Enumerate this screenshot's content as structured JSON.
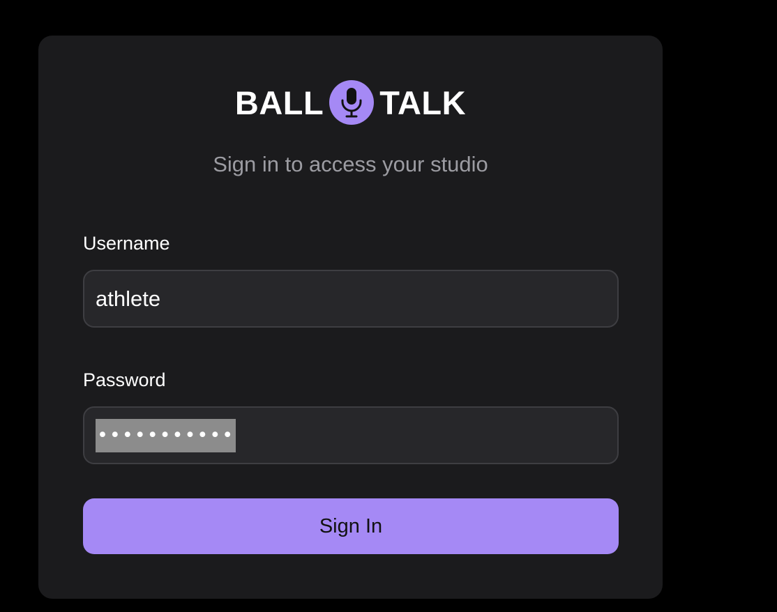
{
  "brand": {
    "word_left": "BALL",
    "word_right": "TALK",
    "icon": "microphone-icon",
    "accent_color": "#a589f5"
  },
  "subtitle": "Sign in to access your studio",
  "form": {
    "username": {
      "label": "Username",
      "value": "athlete"
    },
    "password": {
      "label": "Password",
      "masked_value": "•••••••••••"
    },
    "submit_label": "Sign In"
  },
  "colors": {
    "background": "#000000",
    "card": "#1b1b1d",
    "input_bg": "#27272a",
    "input_border": "#3e3e42",
    "button": "#a589f5"
  }
}
